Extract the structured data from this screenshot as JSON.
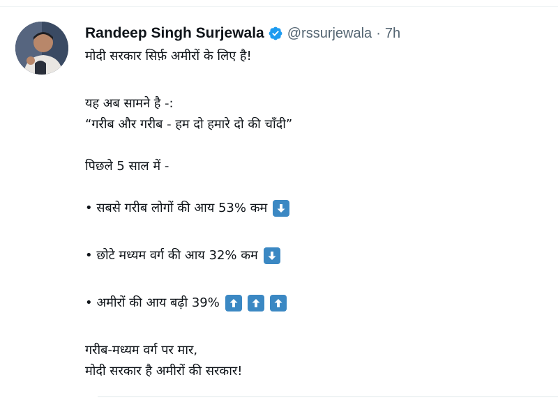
{
  "tweet": {
    "author_name": "Randeep Singh Surjewala",
    "handle": "@rssurjewala",
    "separator": "·",
    "time": "7h",
    "lines": {
      "l1": "मोदी सरकार सिर्फ़ अमीरों के लिए है!",
      "l2": "यह अब सामने है -:",
      "l3": "“गरीब और गरीब - हम दो हमारे दो की चाँदी”",
      "l4": "पिछले 5 साल में -",
      "l5": "• सबसे गरीब लोगों की आय 53% कम",
      "l6": "• छोटे मध्यम वर्ग की आय 32% कम",
      "l7": "• अमीरों की आय बढ़ी 39%",
      "l8": "गरीब-मध्यम वर्ग पर मार,",
      "l9": "मोदी सरकार है अमीरों की सरकार!"
    },
    "icons": {
      "avatar": "profile-photo",
      "verified": "verified-badge-icon",
      "down": "down-arrow-emoji",
      "up": "up-arrow-emoji"
    },
    "colors": {
      "verified": "#1d9bf0",
      "arrow_box": "#3b88c3",
      "secondary_text": "#536471"
    }
  }
}
